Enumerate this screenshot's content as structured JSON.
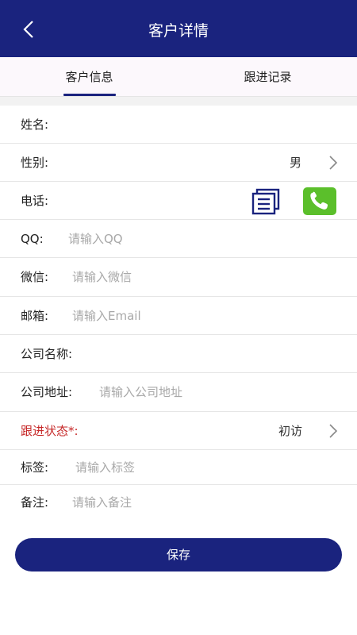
{
  "header": {
    "title": "客户详情"
  },
  "tabs": [
    {
      "label": "客户信息"
    },
    {
      "label": "跟进记录"
    }
  ],
  "form": {
    "name_label": "姓名:",
    "gender_label": "性别:",
    "gender_value": "男",
    "phone_label": "电话:",
    "qq_label": "QQ:",
    "qq_placeholder": "请输入QQ",
    "wechat_label": "微信:",
    "wechat_placeholder": "请输入微信",
    "email_label": "邮箱:",
    "email_placeholder": "请输入Email",
    "company_label": "公司名称:",
    "address_label": "公司地址:",
    "address_placeholder": "请输入公司地址",
    "status_label": "跟进状态*:",
    "status_value": "初访",
    "tag_label": "标签:",
    "tag_placeholder": "请输入标签",
    "note_label": "备注:",
    "note_placeholder": "请输入备注"
  },
  "actions": {
    "save_label": "保存"
  },
  "colors": {
    "primary": "#1a237e",
    "phone_green": "#5bbf2b",
    "required_red": "#c62828"
  }
}
